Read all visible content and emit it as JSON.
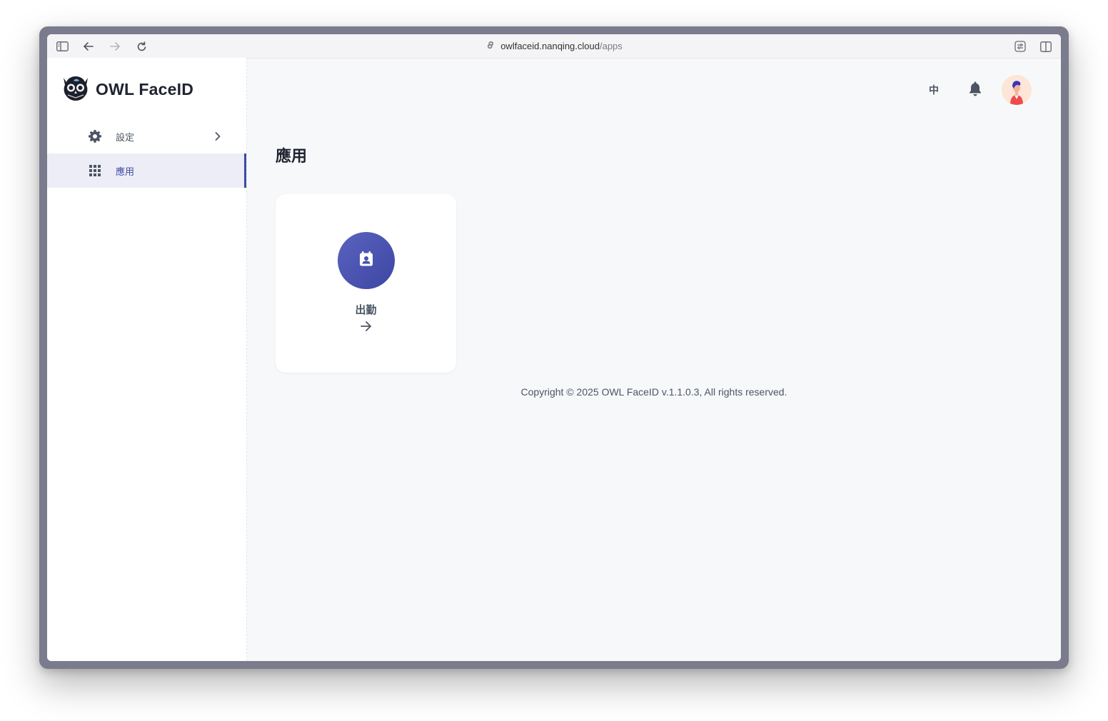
{
  "browser": {
    "url_host": "owlfaceid.nanqing.cloud",
    "url_path": "/apps",
    "icons": [
      "sidebar-toggle-icon",
      "back-arrow-icon",
      "forward-arrow-icon",
      "reload-icon",
      "link-icon",
      "extension-icon",
      "split-view-icon"
    ]
  },
  "brand": {
    "name": "OWL FaceID",
    "logo_icon": "owl-logo-icon"
  },
  "sidebar": {
    "items": [
      {
        "label": "設定",
        "icon": "gear-icon",
        "has_children": true,
        "active": false
      },
      {
        "label": "應用",
        "icon": "grid-icon",
        "has_children": false,
        "active": true
      }
    ]
  },
  "header": {
    "language_label": "中",
    "notification_icon": "bell-icon",
    "avatar_icon": "user-avatar"
  },
  "main": {
    "title": "應用",
    "apps": [
      {
        "label": "出勤",
        "icon": "calendar-user-icon"
      }
    ]
  },
  "footer": {
    "copyright": "Copyright © 2025 OWL FaceID v.1.1.0.3, All rights reserved."
  },
  "colors": {
    "accent": "#3f4aa6",
    "background": "#f7f8fa",
    "text": "#1f2430",
    "muted": "#4b5563"
  }
}
